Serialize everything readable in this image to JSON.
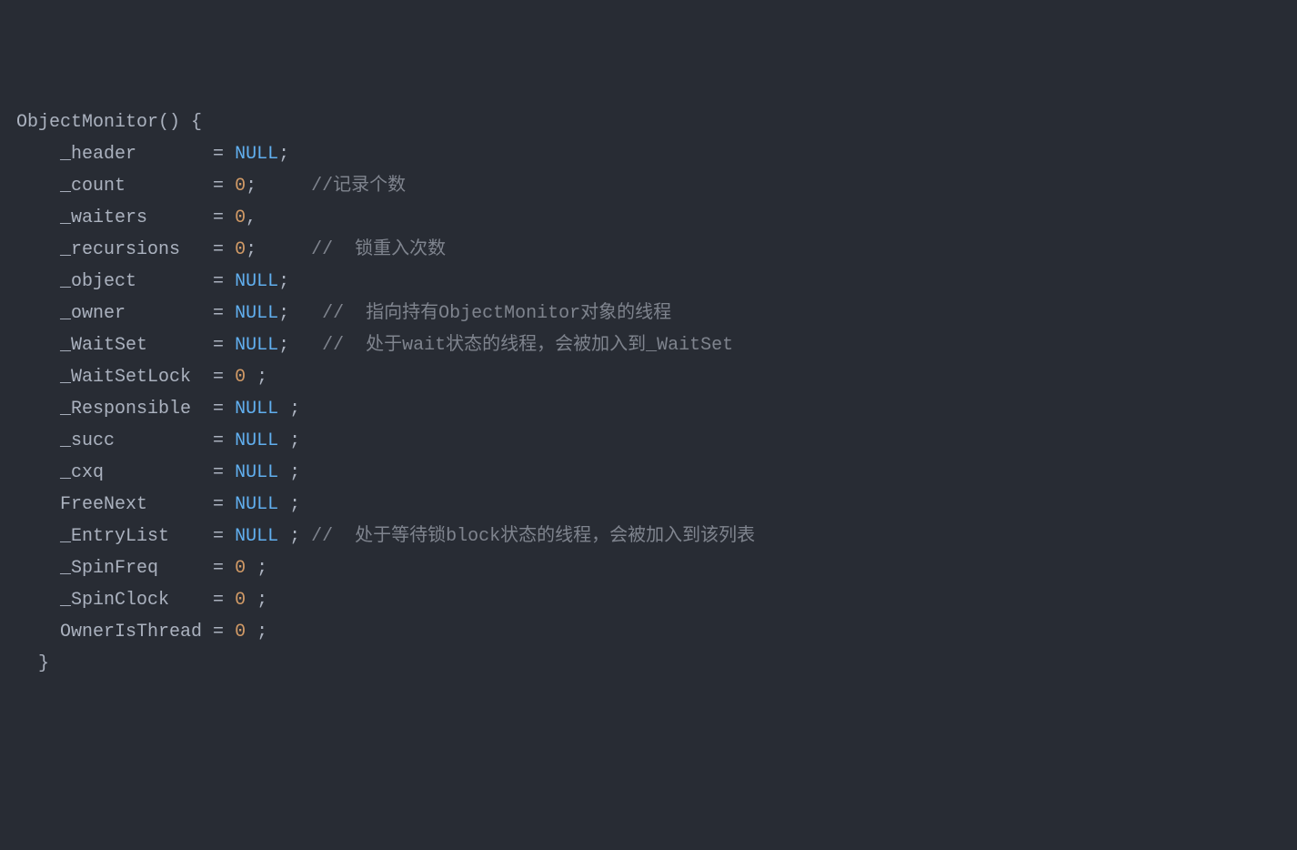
{
  "code": {
    "lines": [
      {
        "indent": 0,
        "parts": [
          {
            "type": "identifier",
            "text": "ObjectMonitor() "
          },
          {
            "type": "brace",
            "text": "{"
          }
        ]
      },
      {
        "indent": 1,
        "parts": [
          {
            "type": "identifier",
            "text": "_header       "
          },
          {
            "type": "operator",
            "text": "= "
          },
          {
            "type": "keyword-null",
            "text": "NULL"
          },
          {
            "type": "semicolon",
            "text": ";"
          }
        ]
      },
      {
        "indent": 1,
        "parts": [
          {
            "type": "identifier",
            "text": "_count        "
          },
          {
            "type": "operator",
            "text": "= "
          },
          {
            "type": "number",
            "text": "0"
          },
          {
            "type": "semicolon",
            "text": ";     "
          },
          {
            "type": "comment",
            "text": "//记录个数"
          }
        ]
      },
      {
        "indent": 1,
        "parts": [
          {
            "type": "identifier",
            "text": "_waiters      "
          },
          {
            "type": "operator",
            "text": "= "
          },
          {
            "type": "number",
            "text": "0"
          },
          {
            "type": "semicolon",
            "text": ","
          }
        ]
      },
      {
        "indent": 1,
        "parts": [
          {
            "type": "identifier",
            "text": "_recursions   "
          },
          {
            "type": "operator",
            "text": "= "
          },
          {
            "type": "number",
            "text": "0"
          },
          {
            "type": "semicolon",
            "text": ";     "
          },
          {
            "type": "comment",
            "text": "//  锁重入次数"
          }
        ]
      },
      {
        "indent": 1,
        "parts": [
          {
            "type": "identifier",
            "text": "_object       "
          },
          {
            "type": "operator",
            "text": "= "
          },
          {
            "type": "keyword-null",
            "text": "NULL"
          },
          {
            "type": "semicolon",
            "text": ";"
          }
        ]
      },
      {
        "indent": 1,
        "parts": [
          {
            "type": "identifier",
            "text": "_owner        "
          },
          {
            "type": "operator",
            "text": "= "
          },
          {
            "type": "keyword-null",
            "text": "NULL"
          },
          {
            "type": "semicolon",
            "text": ";   "
          },
          {
            "type": "comment",
            "text": "//  指向持有ObjectMonitor对象的线程"
          }
        ]
      },
      {
        "indent": 1,
        "parts": [
          {
            "type": "identifier",
            "text": "_WaitSet      "
          },
          {
            "type": "operator",
            "text": "= "
          },
          {
            "type": "keyword-null",
            "text": "NULL"
          },
          {
            "type": "semicolon",
            "text": ";   "
          },
          {
            "type": "comment",
            "text": "//  处于wait状态的线程，会被加入到_WaitSet"
          }
        ]
      },
      {
        "indent": 1,
        "parts": [
          {
            "type": "identifier",
            "text": "_WaitSetLock  "
          },
          {
            "type": "operator",
            "text": "= "
          },
          {
            "type": "number",
            "text": "0"
          },
          {
            "type": "semicolon",
            "text": " ;"
          }
        ]
      },
      {
        "indent": 1,
        "parts": [
          {
            "type": "identifier",
            "text": "_Responsible  "
          },
          {
            "type": "operator",
            "text": "= "
          },
          {
            "type": "keyword-null",
            "text": "NULL"
          },
          {
            "type": "semicolon",
            "text": " ;"
          }
        ]
      },
      {
        "indent": 1,
        "parts": [
          {
            "type": "identifier",
            "text": "_succ         "
          },
          {
            "type": "operator",
            "text": "= "
          },
          {
            "type": "keyword-null",
            "text": "NULL"
          },
          {
            "type": "semicolon",
            "text": " ;"
          }
        ]
      },
      {
        "indent": 1,
        "parts": [
          {
            "type": "identifier",
            "text": "_cxq          "
          },
          {
            "type": "operator",
            "text": "= "
          },
          {
            "type": "keyword-null",
            "text": "NULL"
          },
          {
            "type": "semicolon",
            "text": " ;"
          }
        ]
      },
      {
        "indent": 1,
        "parts": [
          {
            "type": "identifier",
            "text": "FreeNext      "
          },
          {
            "type": "operator",
            "text": "= "
          },
          {
            "type": "keyword-null",
            "text": "NULL"
          },
          {
            "type": "semicolon",
            "text": " ;"
          }
        ]
      },
      {
        "indent": 1,
        "parts": [
          {
            "type": "identifier",
            "text": "_EntryList    "
          },
          {
            "type": "operator",
            "text": "= "
          },
          {
            "type": "keyword-null",
            "text": "NULL"
          },
          {
            "type": "semicolon",
            "text": " ; "
          },
          {
            "type": "comment",
            "text": "//  处于等待锁block状态的线程，会被加入到该列表"
          }
        ]
      },
      {
        "indent": 1,
        "parts": [
          {
            "type": "identifier",
            "text": "_SpinFreq     "
          },
          {
            "type": "operator",
            "text": "= "
          },
          {
            "type": "number",
            "text": "0"
          },
          {
            "type": "semicolon",
            "text": " ;"
          }
        ]
      },
      {
        "indent": 1,
        "parts": [
          {
            "type": "identifier",
            "text": "_SpinClock    "
          },
          {
            "type": "operator",
            "text": "= "
          },
          {
            "type": "number",
            "text": "0"
          },
          {
            "type": "semicolon",
            "text": " ;"
          }
        ]
      },
      {
        "indent": 1,
        "parts": [
          {
            "type": "identifier",
            "text": "OwnerIsThread "
          },
          {
            "type": "operator",
            "text": "= "
          },
          {
            "type": "number",
            "text": "0"
          },
          {
            "type": "semicolon",
            "text": " ;"
          }
        ]
      },
      {
        "indent": 0,
        "parts": [
          {
            "type": "identifier",
            "text": "  "
          },
          {
            "type": "brace",
            "text": "}"
          }
        ]
      }
    ]
  }
}
